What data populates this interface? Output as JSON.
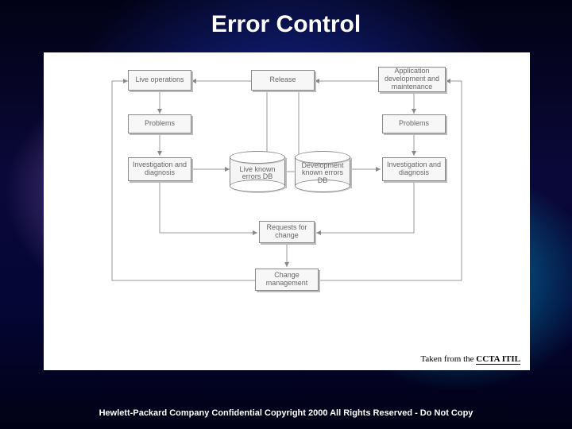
{
  "title": "Error Control",
  "boxes": {
    "live_ops": "Live operations",
    "release": "Release",
    "app_dev": "Application development and maintenance",
    "problems_l": "Problems",
    "problems_r": "Problems",
    "invdiag_l": "Investigation and diagnosis",
    "invdiag_r": "Investigation and diagnosis",
    "rfc": "Requests for change",
    "change_mgmt": "Change management"
  },
  "cylinders": {
    "live_db": "Live known errors DB",
    "dev_db": "Development known errors DB"
  },
  "credit_prefix": "Taken from the ",
  "credit_bold": "CCTA ITIL",
  "footer": "Hewlett-Packard Company Confidential Copyright 2000 All Rights Reserved - Do Not Copy"
}
